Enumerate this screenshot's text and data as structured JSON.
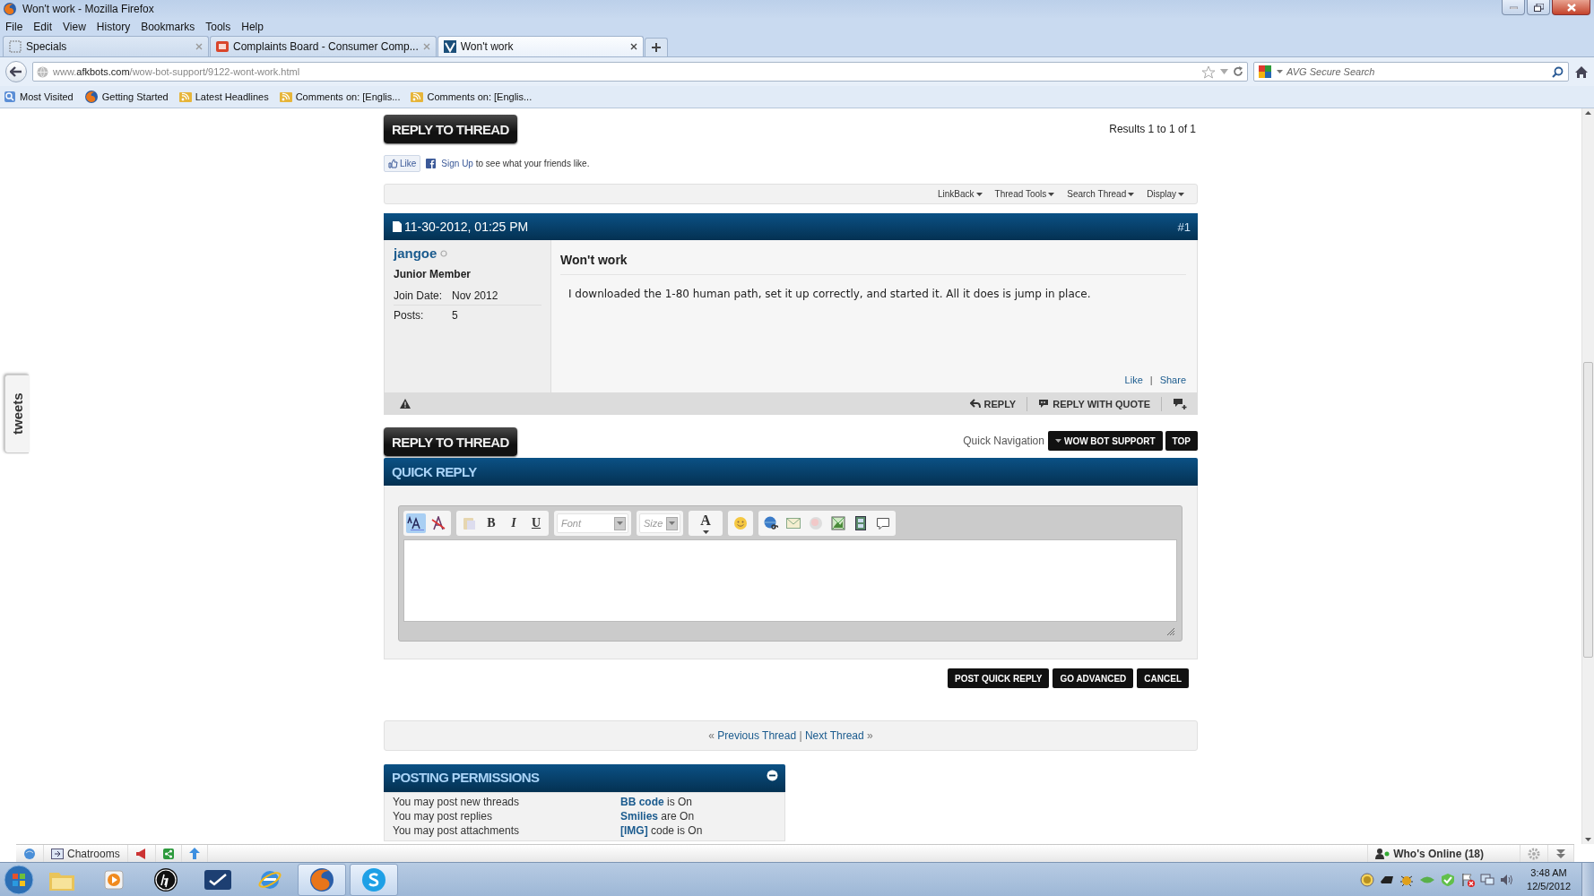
{
  "window": {
    "title": "Won't work - Mozilla Firefox"
  },
  "menu": [
    "File",
    "Edit",
    "View",
    "History",
    "Bookmarks",
    "Tools",
    "Help"
  ],
  "tabs": [
    {
      "label": "Specials",
      "kind": "blank",
      "selected": false
    },
    {
      "label": "Complaints Board - Consumer Comp...",
      "kind": "cb",
      "selected": false
    },
    {
      "label": "Won't work",
      "kind": "site",
      "selected": true
    }
  ],
  "address": {
    "url": "www.**afkbots.com**/wow-bot-support/9122-wont-work.html"
  },
  "search": {
    "placeholder": "AVG Secure Search"
  },
  "bookmarks": [
    {
      "label": "Most Visited",
      "kind": "folder"
    },
    {
      "label": "Getting Started",
      "kind": "firefox"
    },
    {
      "label": "Latest Headlines",
      "kind": "feed"
    },
    {
      "label": "Comments on: [Englis...",
      "kind": "feed"
    },
    {
      "label": "Comments on: [Englis...",
      "kind": "feed"
    }
  ],
  "tweets_tab": {
    "label": "tweets"
  },
  "thread": {
    "reply_button": "REPLY TO THREAD",
    "results": "Results 1 to 1 of 1",
    "like_button": "Like",
    "signup_link": "Sign Up",
    "signup_text": "to see what your friends like.",
    "tools": [
      "LinkBack",
      "Thread Tools",
      "Search Thread",
      "Display"
    ]
  },
  "post": {
    "date": "11-30-2012, 01:25 PM",
    "number": "#1",
    "username": "jangoe",
    "online": false,
    "rank": "Junior Member",
    "fields": [
      {
        "label": "Join Date:",
        "value": "Nov 2012"
      },
      {
        "label": "Posts:",
        "value": "5"
      }
    ],
    "title": "Won't work",
    "body": "I downloaded the 1-80 human path, set it up correctly, and started it. All it does is jump in place.",
    "like_link": "Like",
    "link_separator": "|",
    "share_link": "Share",
    "actions": [
      "REPLY",
      "REPLY WITH QUOTE"
    ]
  },
  "quick_nav": {
    "reply_button": "REPLY TO THREAD",
    "label": "Quick Navigation",
    "forum_button": "WOW BOT SUPPORT",
    "top_button": "TOP"
  },
  "quick_reply": {
    "title": "QUICK REPLY",
    "toolbar": [
      {
        "kind": "mode",
        "on": true
      },
      {
        "kind": "removeformat",
        "on": false
      },
      {
        "kind": "paste",
        "on": false
      },
      {
        "kind": "bold",
        "text": "B",
        "on": false
      },
      {
        "kind": "italic",
        "text": "I",
        "on": false
      },
      {
        "kind": "underline",
        "text": "U",
        "on": false
      },
      {
        "kind": "select",
        "text": "Font",
        "on": false
      },
      {
        "kind": "select",
        "text": "Size",
        "on": false
      },
      {
        "kind": "color",
        "text": "A",
        "on": false
      },
      {
        "kind": "smilie",
        "on": false
      },
      {
        "kind": "link",
        "on": false
      },
      {
        "kind": "email",
        "on": false
      },
      {
        "kind": "unlink",
        "on": false
      },
      {
        "kind": "image",
        "on": false
      },
      {
        "kind": "video",
        "on": false
      },
      {
        "kind": "quote",
        "on": false
      }
    ],
    "buttons": [
      "POST QUICK REPLY",
      "GO ADVANCED",
      "CANCEL"
    ]
  },
  "thread_nav": {
    "prev_mark": "«",
    "prev": "Previous Thread",
    "separator": "|",
    "next": "Next Thread",
    "next_mark": "»"
  },
  "permissions": {
    "title": "POSTING PERMISSIONS",
    "left": [
      "You may post new threads",
      "You may post replies",
      "You may post attachments"
    ],
    "right": [
      "**BB code** is On",
      "**Smilies** are On",
      "**[IMG]** code is On"
    ]
  },
  "chat_bar": {
    "chatrooms": "Chatrooms",
    "whos_online": "Who's Online (18)"
  },
  "taskbar": {
    "apps": [
      {
        "kind": "explorer",
        "selected": false
      },
      {
        "kind": "media",
        "selected": false
      },
      {
        "kind": "hp",
        "selected": false
      },
      {
        "kind": "check",
        "selected": false
      },
      {
        "kind": "ie",
        "selected": false
      },
      {
        "kind": "firefox",
        "selected": true
      },
      {
        "kind": "skype",
        "selected": true
      }
    ],
    "time": "3:48 AM",
    "date": "12/5/2012"
  }
}
